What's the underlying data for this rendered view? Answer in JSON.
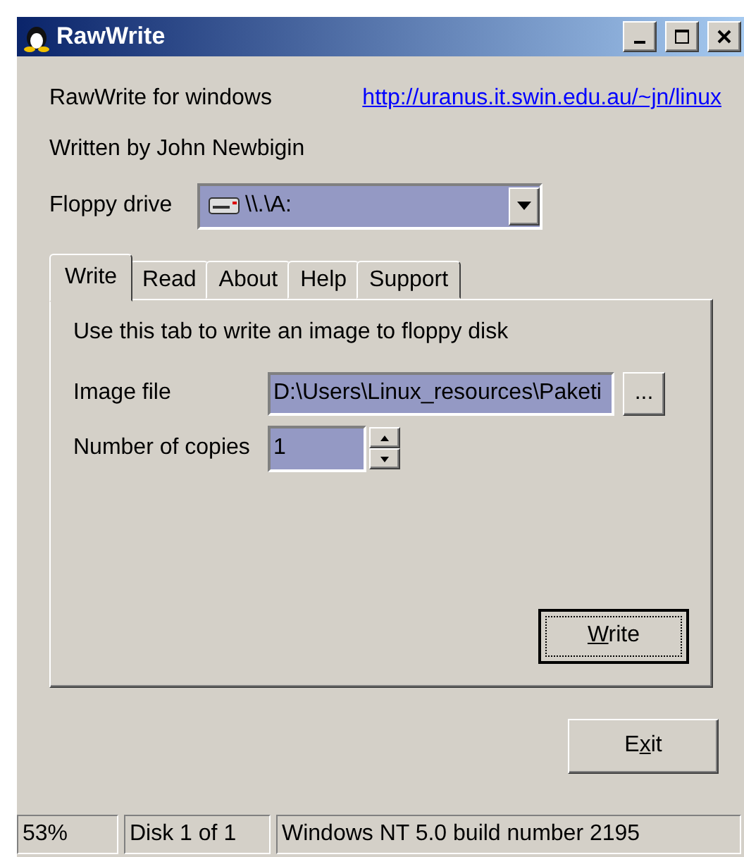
{
  "window": {
    "title": "RawWrite"
  },
  "header": {
    "app_name": "RawWrite for windows",
    "link": "http://uranus.it.swin.edu.au/~jn/linux",
    "author": "Written by John Newbigin"
  },
  "floppy_drive": {
    "label": "Floppy drive",
    "value": "\\\\.\\A:"
  },
  "tabs": [
    {
      "label": "Write",
      "selected": true
    },
    {
      "label": "Read",
      "selected": false
    },
    {
      "label": "About",
      "selected": false
    },
    {
      "label": "Help",
      "selected": false
    },
    {
      "label": "Support",
      "selected": false
    }
  ],
  "write_tab": {
    "description": "Use this tab to write an image to floppy disk",
    "image_file_label": "Image file",
    "image_file": "D:\\Users\\Linux_resources\\Paketi",
    "browse": "...",
    "copies_label": "Number of copies",
    "copies": "1",
    "action": {
      "label_parts": [
        {
          "text": "W",
          "underlined": true
        },
        {
          "text": "rite",
          "underlined": false
        }
      ],
      "focused": true
    }
  },
  "exit": {
    "label_parts": [
      {
        "text": "E",
        "underlined": false
      },
      {
        "text": "x",
        "underlined": true
      },
      {
        "text": "it",
        "underlined": false
      }
    ],
    "focused": false
  },
  "status_bar": [
    "53%",
    "Disk 1 of 1",
    "Windows NT 5.0 build number 2195"
  ]
}
